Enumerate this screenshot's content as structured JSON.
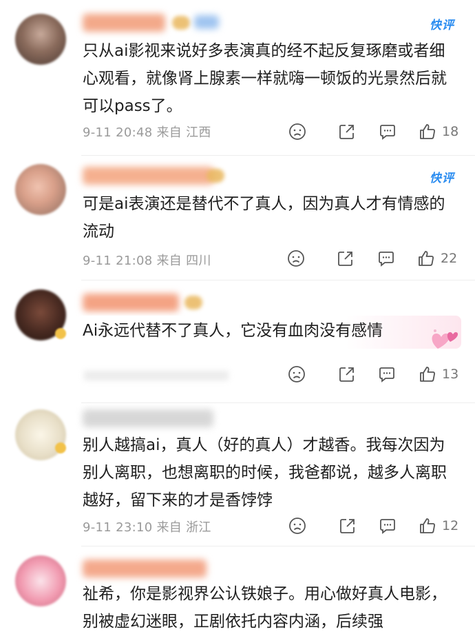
{
  "comments": [
    {
      "text": "只从ai影视来说好多表演真的经不起反复琢磨或者细心观看，就像肾上腺素一样就嗨一顿饭的光景然后就可以pass了。",
      "meta": "9-11 20:48 来自 江西",
      "badge": "快评",
      "likes": "18",
      "colors": {
        "avatar": "#8a6b5c",
        "name": "#f3a98a"
      }
    },
    {
      "text": "可是ai表演还是替代不了真人，因为真人才有情感的流动",
      "meta": "9-11 21:08 来自 四川",
      "badge": "快评",
      "likes": "22",
      "colors": {
        "avatar": "#d9a08a",
        "name": "#f5b08f"
      }
    },
    {
      "text": "Ai永远代替不了真人，它没有血肉没有感情",
      "meta": "",
      "badge": "",
      "likes": "13",
      "colors": {
        "avatar": "#4a2b22",
        "name": "#f4a384"
      }
    },
    {
      "text": "别人越搞ai，真人（好的真人）才越香。我每次因为别人离职，也想离职的时候，我爸都说，越多人离职越好，留下来的才是香饽饽",
      "meta": "9-11 23:10 来自 浙江",
      "badge": "",
      "likes": "12",
      "colors": {
        "avatar": "#e8dfc8",
        "name": "#bdbdbd"
      }
    },
    {
      "text": "祉希，你是影视界公认铁娘子。用心做好真人电影，别被虚幻迷眼，正剧依托内容内涵，后续强",
      "meta": "",
      "badge": "",
      "likes": "",
      "colors": {
        "avatar": "#f19ab0",
        "name": "#f4a98c"
      }
    }
  ],
  "icons": [
    "sad-face-icon",
    "share-icon",
    "comment-icon",
    "thumb-up-icon"
  ]
}
